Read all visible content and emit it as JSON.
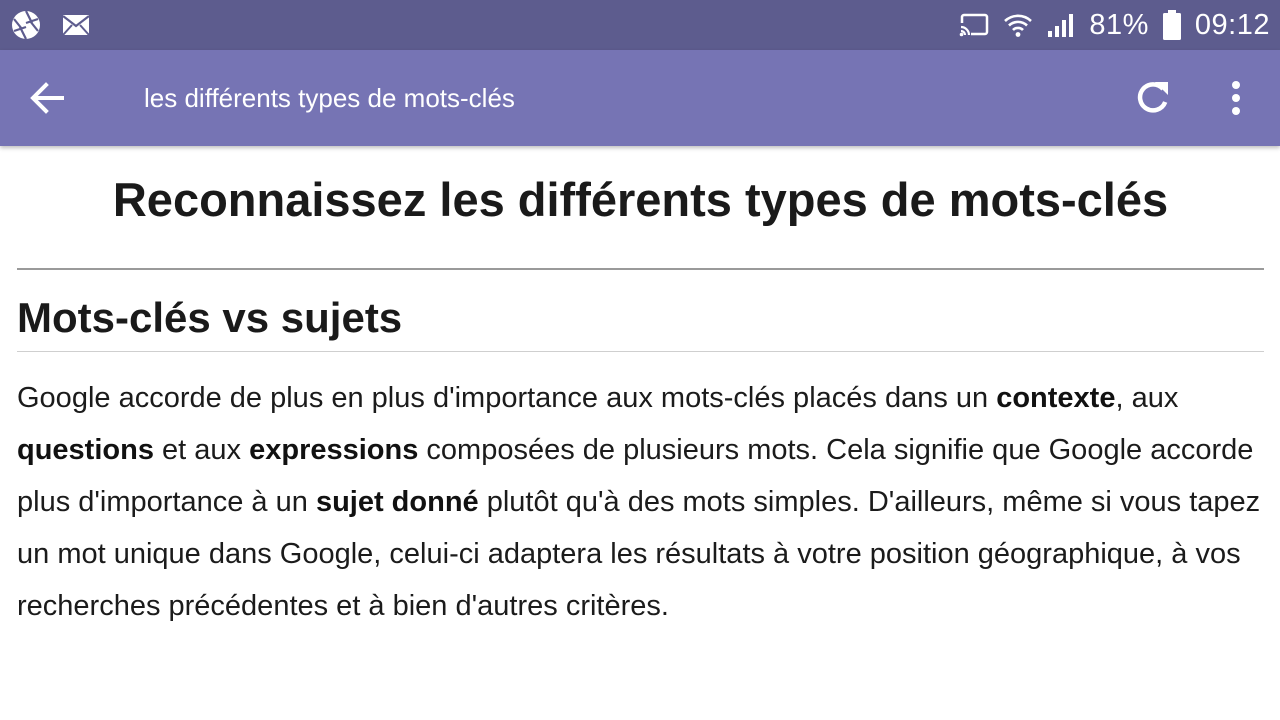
{
  "status_bar": {
    "left_icons": [
      "aperture-icon",
      "mail-icon"
    ],
    "right_icons": [
      "cast-icon",
      "wifi-icon",
      "signal-icon",
      "battery-icon"
    ],
    "battery_percent": "81%",
    "time": "09:12",
    "background_color": "#5d5c8e"
  },
  "app_bar": {
    "title": "les différents types de mots-clés",
    "background_color": "#7674b4",
    "icons": [
      "back-arrow-icon",
      "refresh-icon",
      "more-vert-icon"
    ]
  },
  "article": {
    "title": "Reconnaissez les différents types de mots-clés",
    "section_heading": "Mots-clés vs sujets",
    "paragraph": {
      "p1": "Google accorde de plus en plus d'importance aux mots-clés placés dans un ",
      "b1": "contexte",
      "p2": ", aux ",
      "b2": "questions",
      "p3": " et aux ",
      "b3": "expressions",
      "p4": " composées de plusieurs mots. Cela signifie que Google accorde plus d'importance à un ",
      "b4": "sujet donné",
      "p5": " plutôt qu'à des mots simples. D'ailleurs, même si vous tapez un mot unique dans Google, celui-ci adaptera les résultats à votre position géographique, à vos recherches précédentes et à bien d'autres critères."
    }
  }
}
